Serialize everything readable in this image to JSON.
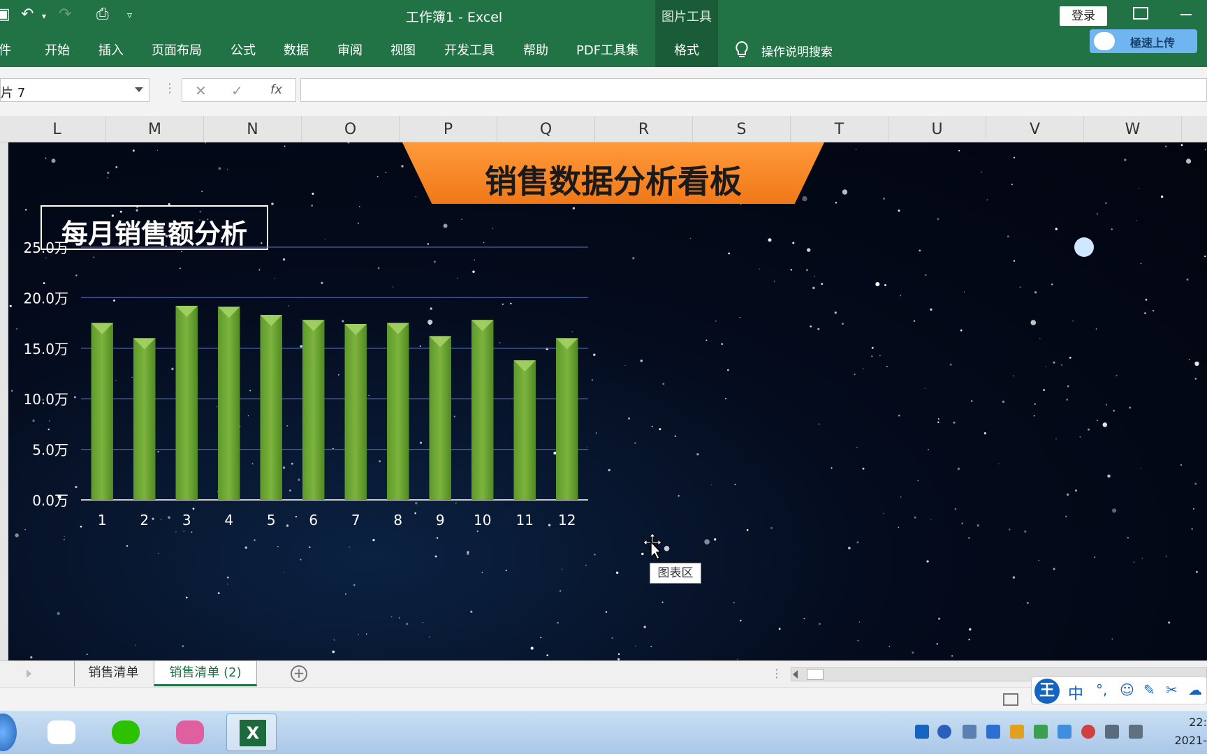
{
  "title_bar": {
    "document_title": "工作簿1  -  Excel",
    "picture_tools": "图片工具",
    "login_label": "登录"
  },
  "ribbon": {
    "tabs": [
      "件",
      "开始",
      "插入",
      "页面布局",
      "公式",
      "数据",
      "审阅",
      "视图",
      "开发工具",
      "帮助",
      "PDF工具集"
    ],
    "active_tab": "格式",
    "search_hint": "操作说明搜索",
    "upload_label": "極速上传"
  },
  "formula_bar": {
    "name_box_value": "片 7",
    "cancel_symbol": "✕",
    "enter_symbol": "✓",
    "fx_symbol": "fx",
    "formula_value": ""
  },
  "columns": [
    "L",
    "M",
    "N",
    "O",
    "P",
    "Q",
    "R",
    "S",
    "T",
    "U",
    "V",
    "W"
  ],
  "dashboard": {
    "banner_title": "销售数据分析看板",
    "chart_title": "每月销售额分析"
  },
  "chart_data": {
    "type": "bar",
    "title": "每月销售额分析",
    "categories": [
      "1",
      "2",
      "3",
      "4",
      "5",
      "6",
      "7",
      "8",
      "9",
      "10",
      "11",
      "12"
    ],
    "values": [
      17.5,
      16.0,
      19.2,
      19.1,
      18.3,
      17.8,
      17.4,
      17.5,
      16.2,
      17.8,
      13.8,
      16.0
    ],
    "y_unit": "万",
    "ylim": [
      0,
      25
    ],
    "y_ticks": [
      "0.0万",
      "5.0万",
      "10.0万",
      "15.0万",
      "20.0万",
      "25.0万"
    ],
    "gridlines": true,
    "bar_color": "#7db33e",
    "legend": "none"
  },
  "chart_tooltip": "图表区",
  "sheet_tabs": [
    "销售清单",
    "销售清单 (2)"
  ],
  "active_sheet": "销售清单 (2)",
  "ime": {
    "logo": "王",
    "mode": "中"
  },
  "taskbar": {
    "clock_time": "22:",
    "clock_date": "2021-"
  },
  "colors": {
    "excel_green": "#217346",
    "banner_orange": "#f07818",
    "bar_green": "#7db33e"
  }
}
